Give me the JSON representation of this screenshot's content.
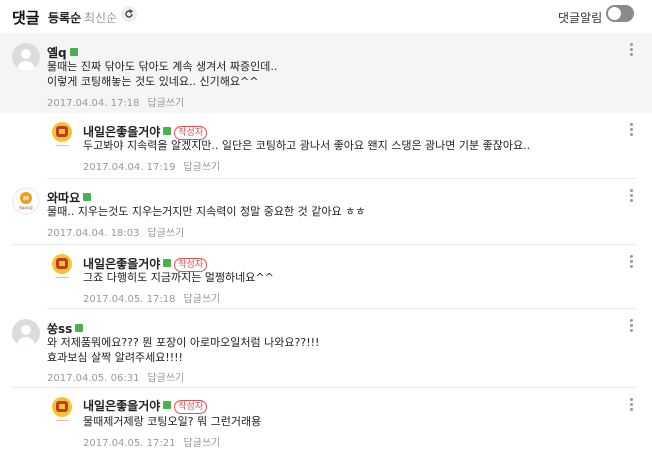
{
  "header": {
    "title": "댓글",
    "sort_registered": "등록순",
    "sort_newest": "최신순",
    "alarm_label": "댓글알림"
  },
  "comments": [
    {
      "name": "옐q",
      "lines": [
        "물때는 진짜 닦아도 닦아도 계속 생겨서 짜증인데..",
        "이렇게 코팅해놓는 것도 있네요.. 신기해요^^"
      ],
      "date": "2017.04.04. 17:18",
      "reply_label": "답글쓰기"
    },
    {
      "name": "내일은좋을거야",
      "author_badge": "작성자",
      "lines": [
        "두고봐야 지속력을 알겠지만.. 일단은 코팅하고 광나서 좋아요 왠지 스댕은 광나면 기분 좋잖아요.."
      ],
      "date": "2017.04.04. 17:19",
      "reply_label": "답글쓰기"
    },
    {
      "name": "와따요",
      "avatar_text": "행복의지문",
      "lines": [
        "물때.. 지우는것도 지우는거지만 지속력이 정말 중요한 것 같아요 ㅎㅎ"
      ],
      "date": "2017.04.04. 18:03",
      "reply_label": "답글쓰기"
    },
    {
      "name": "내일은좋을거야",
      "author_badge": "작성자",
      "lines": [
        "그죠 다행히도 지금까지는 멀쩡하네요^^"
      ],
      "date": "2017.04.05. 17:18",
      "reply_label": "답글쓰기"
    },
    {
      "name": "쏭ss",
      "lines": [
        "와 저제품뭐에요??? 뭔 포장이 아로마오일처럼 나와요??!!!",
        "효과보심 살짝 알려주세요!!!!"
      ],
      "date": "2017.04.05. 06:31",
      "reply_label": "답글쓰기"
    },
    {
      "name": "내일은좋을거야",
      "author_badge": "작성자",
      "lines": [
        "물때제거제랑 코팅오일? 뭐 그런거래용"
      ],
      "date": "2017.04.05. 17:21",
      "reply_label": "답글쓰기"
    }
  ],
  "colors": {
    "author_badge": "#e05050",
    "level_badge": "#4caf50",
    "highlight_bg": "#f5f5f5"
  }
}
